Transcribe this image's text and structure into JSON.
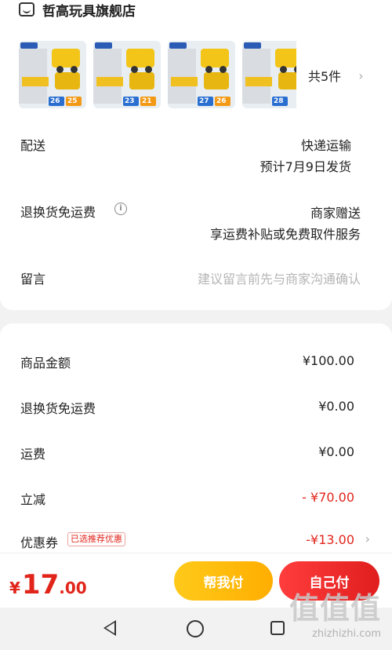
{
  "shop": {
    "name": "哲高玩具旗舰店",
    "icon": "shop-icon"
  },
  "products": {
    "thumbs": [
      {
        "tag_a": "26",
        "tag_b": "25"
      },
      {
        "tag_a": "23",
        "tag_b": "21"
      },
      {
        "tag_a": "27",
        "tag_b": "26"
      },
      {
        "tag_a": "28",
        "tag_b": ""
      }
    ],
    "count_label": "共5件",
    "chevron": "›"
  },
  "delivery": {
    "label": "配送",
    "method": "快递运输",
    "eta": "预计7月9日发货"
  },
  "return_shipping": {
    "label": "退换货免运费",
    "value": "商家赠送",
    "desc": "享运费补贴或免费取件服务",
    "info_icon": "i"
  },
  "message": {
    "label": "留言",
    "placeholder": "建议留言前先与商家沟通确认"
  },
  "summary": {
    "goods_amount": {
      "label": "商品金额",
      "value": "¥100.00"
    },
    "return_fee": {
      "label": "退换货免运费",
      "value": "¥0.00"
    },
    "shipping": {
      "label": "运费",
      "value": "¥0.00"
    },
    "discount": {
      "label": "立减",
      "value": "- ¥70.00"
    },
    "coupon": {
      "label": "优惠券",
      "badge": "已选推荐优惠",
      "value": "-¥13.00",
      "chevron": "›"
    }
  },
  "bottom": {
    "total_symbol": "¥",
    "total_int": "17",
    "total_dec": ".00",
    "help_pay": "帮我付",
    "self_pay": "自己付"
  },
  "watermark": {
    "main": "值值值",
    "sub": "zhizhizhi.com"
  },
  "colors": {
    "accent_red": "#e1251b",
    "help_yellow": "#ffb800",
    "bg": "#f2f2f2"
  }
}
